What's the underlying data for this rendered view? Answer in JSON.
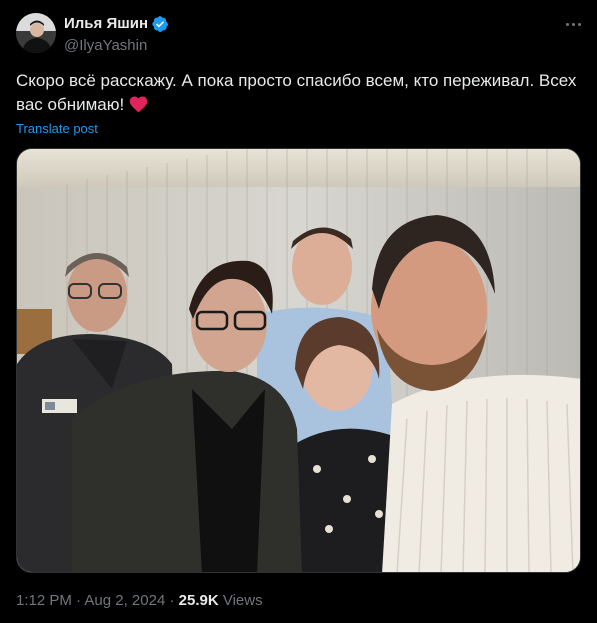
{
  "author": {
    "name": "Илья Яшин",
    "handle": "@IlyaYashin",
    "verified": true
  },
  "post": {
    "text": "Скоро всё расскажу. А пока просто спасибо всем, кто переживал. Всех вас обнимаю!",
    "emoji": "red-heart-icon",
    "translate_label": "Translate post"
  },
  "meta": {
    "time": "1:12 PM",
    "separator": "·",
    "date": "Aug 2, 2024",
    "views_count": "25.9K",
    "views_label": "Views"
  },
  "icons": {
    "more": "more-icon",
    "verified": "verified-badge-icon"
  },
  "colors": {
    "background": "#000000",
    "text": "#e7e9ea",
    "secondary": "#71767b",
    "link": "#1d9bf0",
    "verified": "#1d9bf0",
    "heart": "#e0245e"
  }
}
